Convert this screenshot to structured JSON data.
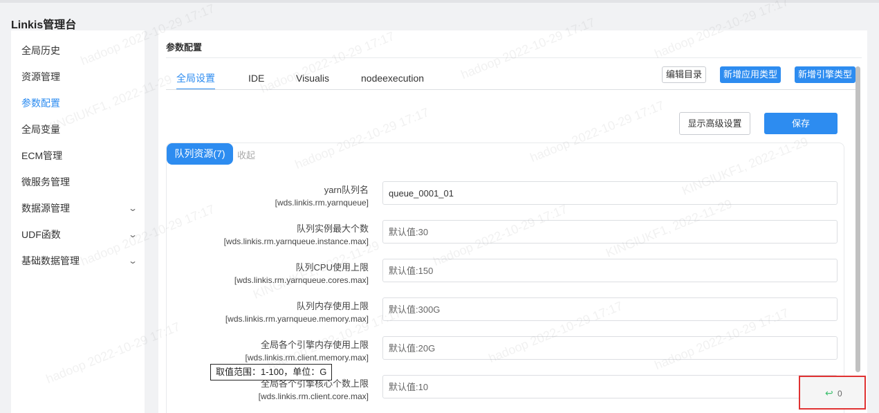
{
  "app": {
    "title": "Linkis管理台"
  },
  "sidebar": {
    "items": [
      {
        "label": "全局历史",
        "active": false,
        "expandable": false
      },
      {
        "label": "资源管理",
        "active": false,
        "expandable": false
      },
      {
        "label": "参数配置",
        "active": true,
        "expandable": false
      },
      {
        "label": "全局变量",
        "active": false,
        "expandable": false
      },
      {
        "label": "ECM管理",
        "active": false,
        "expandable": false
      },
      {
        "label": "微服务管理",
        "active": false,
        "expandable": false
      },
      {
        "label": "数据源管理",
        "active": false,
        "expandable": true
      },
      {
        "label": "UDF函数",
        "active": false,
        "expandable": true
      },
      {
        "label": "基础数据管理",
        "active": false,
        "expandable": true
      }
    ]
  },
  "main": {
    "title": "参数配置",
    "tabs": [
      {
        "label": "全局设置",
        "active": true
      },
      {
        "label": "IDE",
        "active": false
      },
      {
        "label": "Visualis",
        "active": false
      },
      {
        "label": "nodeexecution",
        "active": false
      }
    ],
    "toolbar": {
      "edit_catalog": "编辑目录",
      "add_app_type": "新增应用类型",
      "add_engine_type": "新增引擎类型"
    },
    "actions": {
      "show_advanced": "显示高级设置",
      "save": "保存"
    },
    "section": {
      "title": "队列资源(7)",
      "collapse": "收起",
      "fields": [
        {
          "label": "yarn队列名",
          "key": "[wds.linkis.rm.yarnqueue]",
          "value": "queue_0001_01",
          "placeholder": ""
        },
        {
          "label": "队列实例最大个数",
          "key": "[wds.linkis.rm.yarnqueue.instance.max]",
          "value": "",
          "placeholder": "默认值:30"
        },
        {
          "label": "队列CPU使用上限",
          "key": "[wds.linkis.rm.yarnqueue.cores.max]",
          "value": "",
          "placeholder": "默认值:150"
        },
        {
          "label": "队列内存使用上限",
          "key": "[wds.linkis.rm.yarnqueue.memory.max]",
          "value": "",
          "placeholder": "默认值:300G"
        },
        {
          "label": "全局各个引擎内存使用上限",
          "key": "[wds.linkis.rm.client.memory.max]",
          "value": "",
          "placeholder": "默认值:20G"
        },
        {
          "label": "全局各个引擎核心个数上限",
          "key": "[wds.linkis.rm.client.core.max]",
          "value": "",
          "placeholder": "默认值:10"
        }
      ]
    }
  },
  "tooltip": {
    "text": "取值范围：1-100，单位：G"
  },
  "counter": {
    "icon": "return-arrow-icon",
    "value": "0"
  },
  "watermark": {
    "texts": [
      "hadoop 2022-10-29 17:17",
      "KINGlUKF1, 2022-11-29"
    ]
  },
  "colors": {
    "accent": "#2d8cf0",
    "highlight": "#e03131"
  }
}
